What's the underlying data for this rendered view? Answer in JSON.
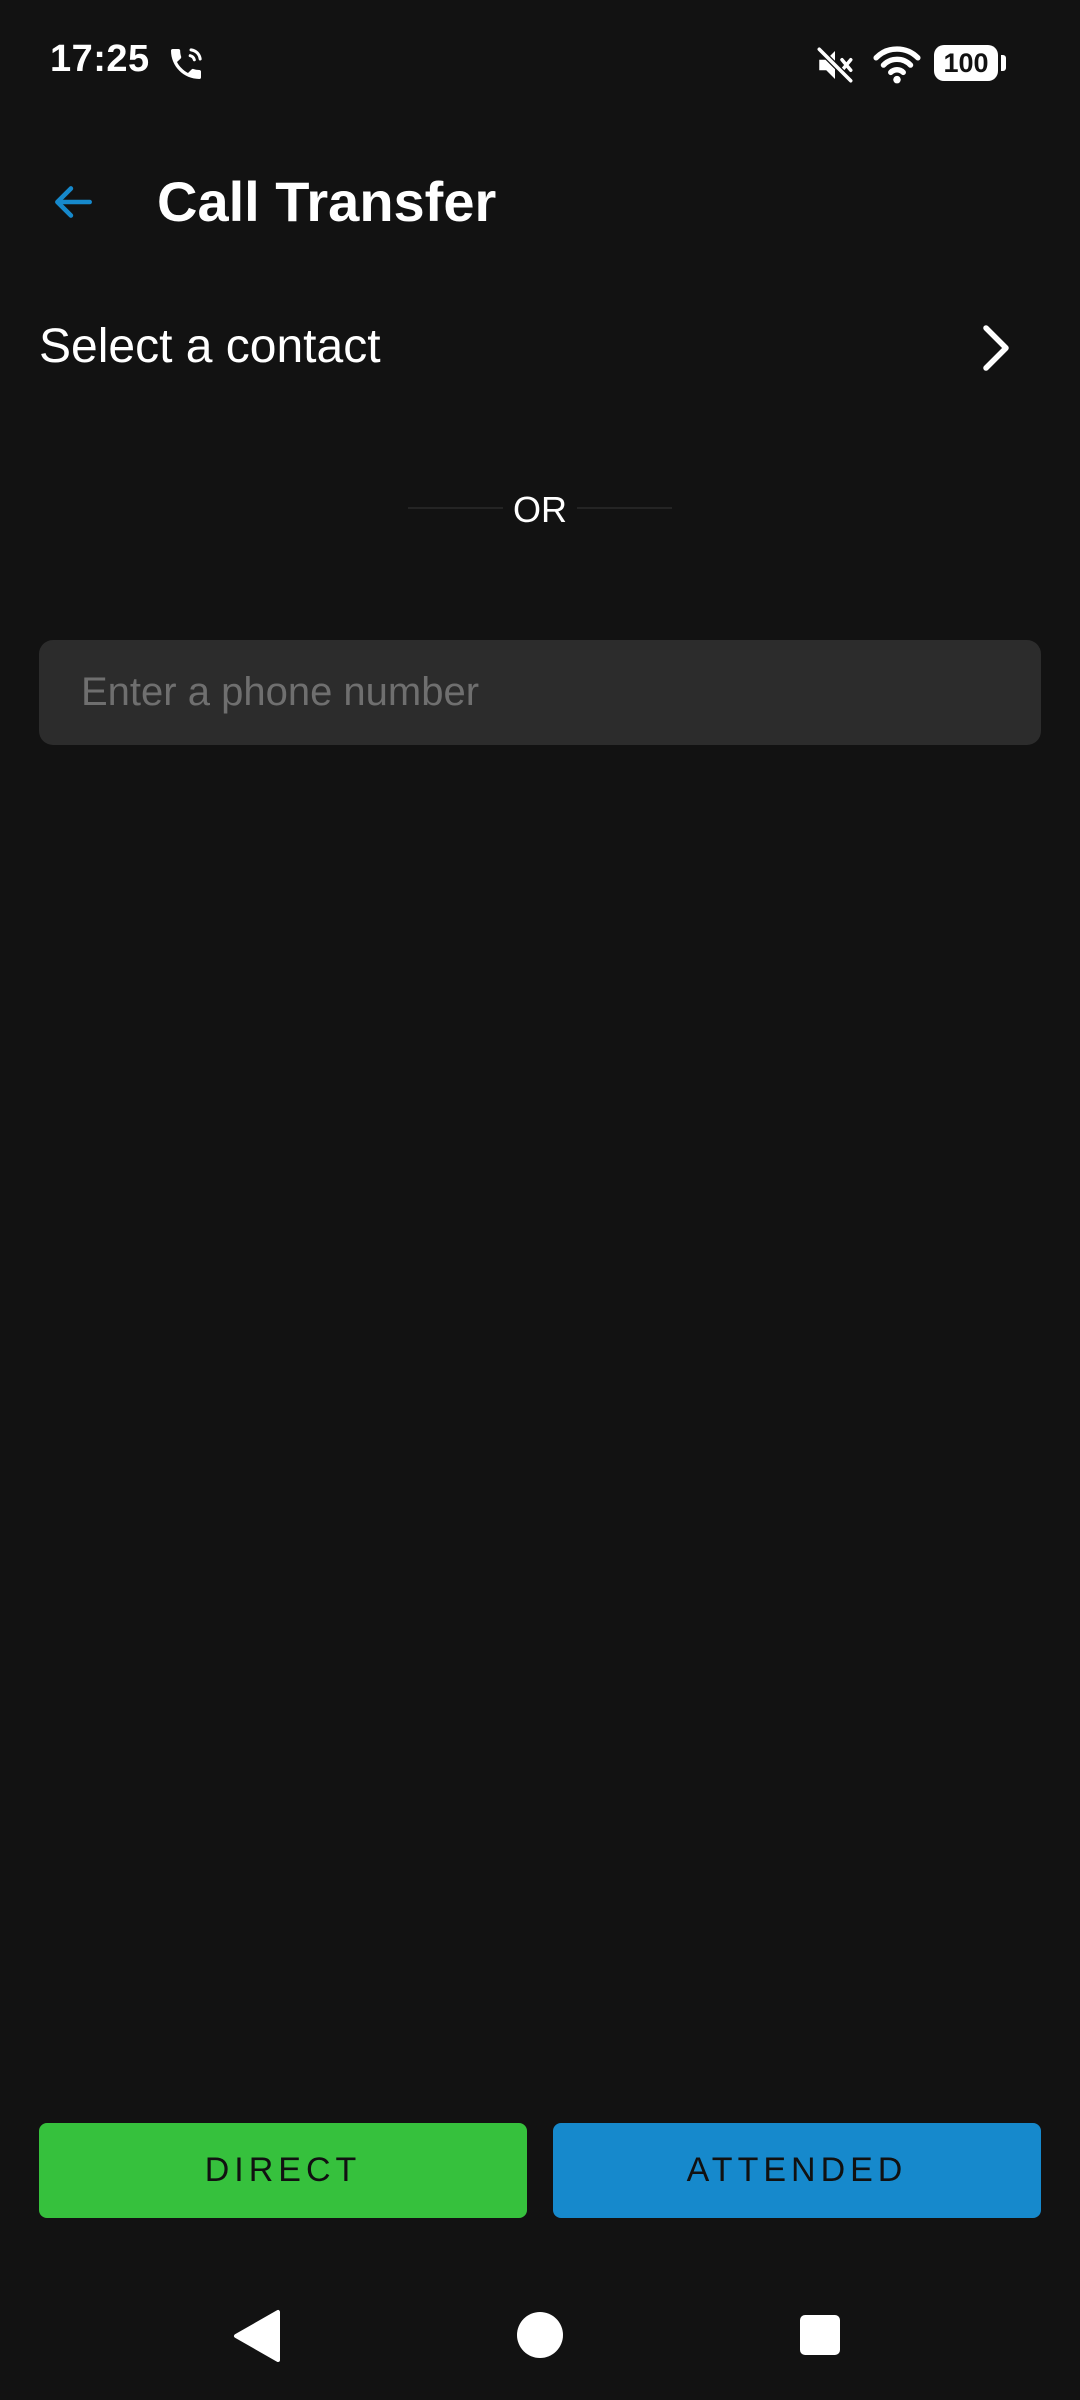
{
  "status_bar": {
    "time": "17:25",
    "battery_level": "100",
    "icons": [
      "phone-call-icon",
      "mute-icon",
      "wifi-icon",
      "battery-icon"
    ]
  },
  "app_bar": {
    "title": "Call Transfer",
    "back_icon": "arrow-left-icon"
  },
  "contact_row": {
    "label": "Select a contact",
    "icon": "chevron-right-icon"
  },
  "divider": {
    "text": "OR"
  },
  "phone_input": {
    "value": "",
    "placeholder": "Enter a phone number"
  },
  "actions": {
    "direct_label": "DIRECT",
    "attended_label": "ATTENDED"
  },
  "colors": {
    "background": "#121212",
    "accent_blue": "#1689cc",
    "accent_green": "#36c13d",
    "input_background": "#2c2c2c"
  },
  "nav_bar": {
    "icons": [
      "nav-back-icon",
      "nav-home-icon",
      "nav-recents-icon"
    ]
  }
}
